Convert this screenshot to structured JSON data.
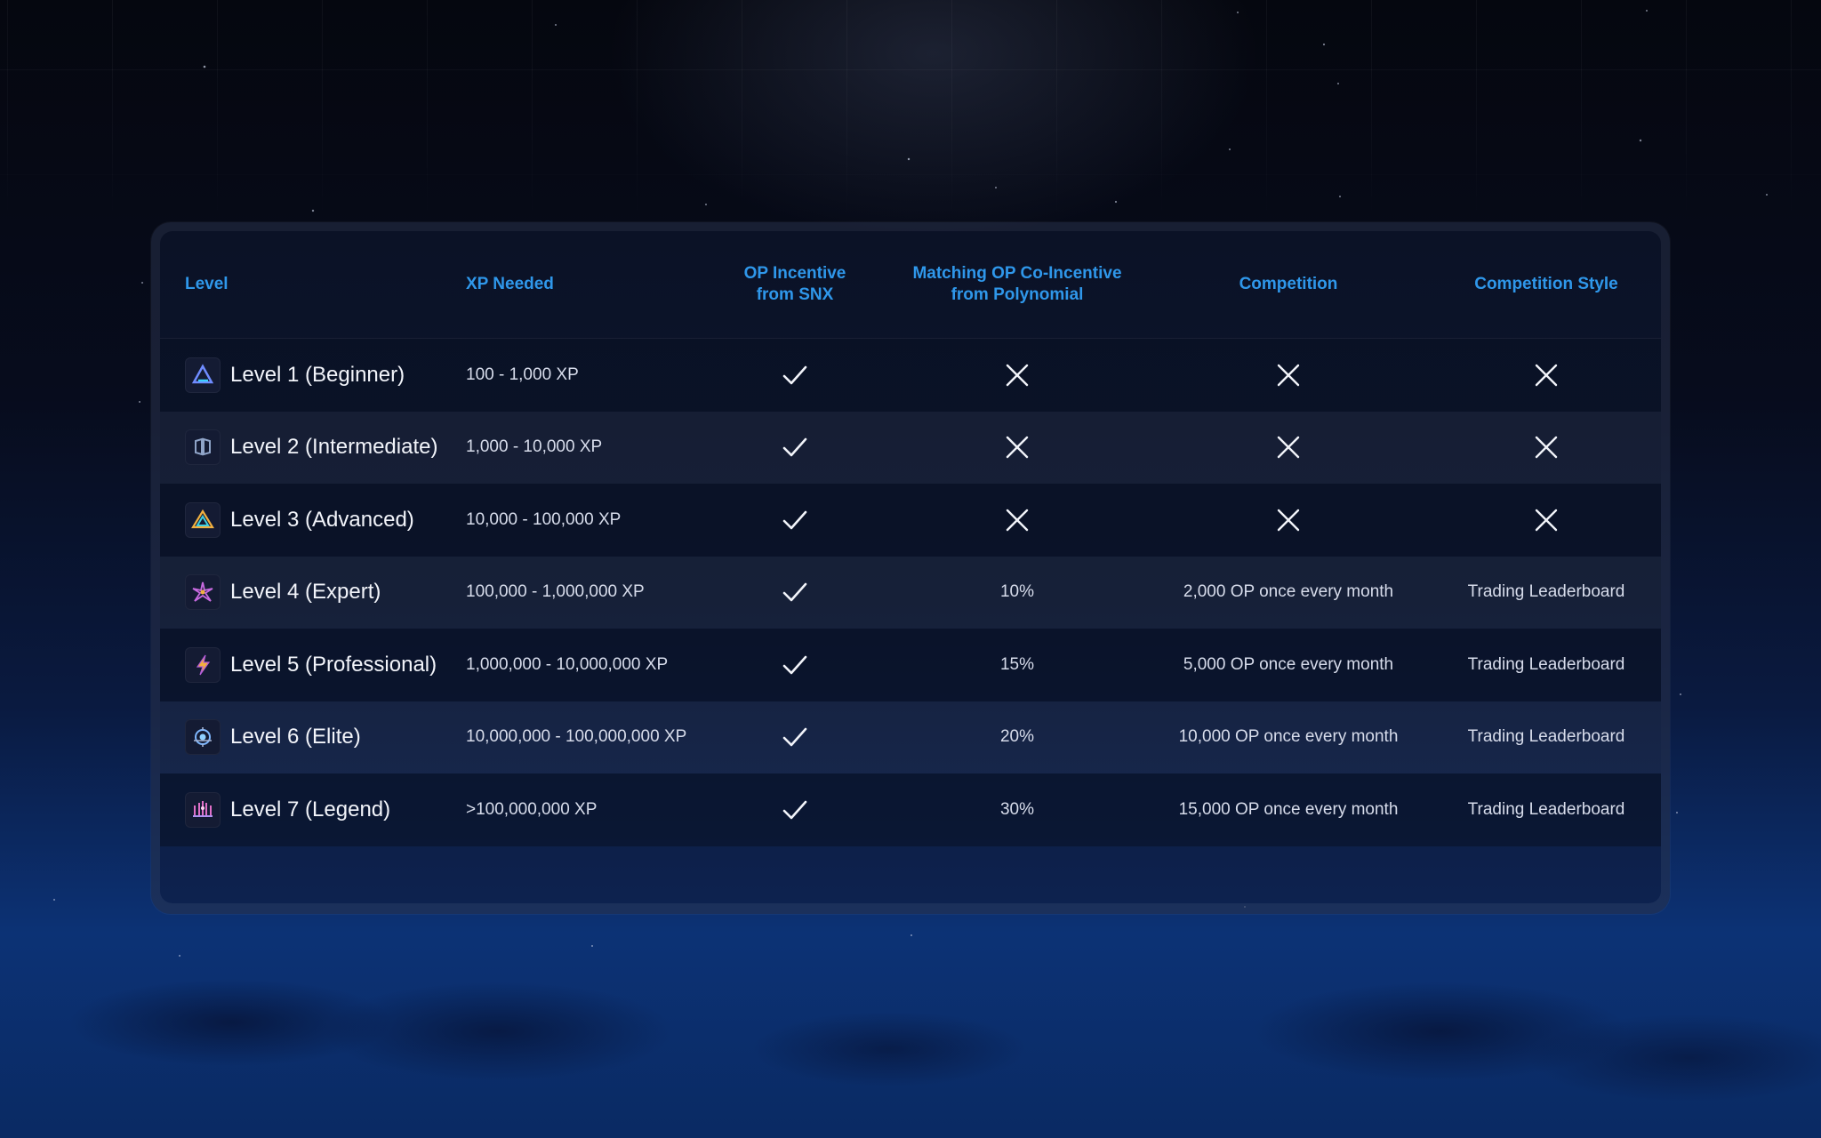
{
  "table": {
    "headers": {
      "level": "Level",
      "xp": "XP Needed",
      "op_snx": "OP Incentive\nfrom SNX",
      "matching": "Matching OP Co-Incentive\nfrom Polynomial",
      "competition": "Competition",
      "style": "Competition Style"
    },
    "rows": [
      {
        "level": "Level 1 (Beginner)",
        "xp": "100 - 1,000 XP",
        "op_snx": "check",
        "matching": "cross",
        "competition": "cross",
        "style": "cross",
        "icon": "triangle-icon"
      },
      {
        "level": "Level  2 (Intermediate)",
        "xp": "1,000 - 10,000 XP",
        "op_snx": "check",
        "matching": "cross",
        "competition": "cross",
        "style": "cross",
        "icon": "cube-icon"
      },
      {
        "level": "Level 3 (Advanced)",
        "xp": "10,000 - 100,000 XP",
        "op_snx": "check",
        "matching": "cross",
        "competition": "cross",
        "style": "cross",
        "icon": "prism-icon"
      },
      {
        "level": "Level 4 (Expert)",
        "xp": "100,000 - 1,000,000 XP",
        "op_snx": "check",
        "matching": "10%",
        "competition": "2,000 OP once every month",
        "style": "Trading Leaderboard",
        "icon": "burst-icon"
      },
      {
        "level": "Level 5 (Professional)",
        "xp": "1,000,000 - 10,000,000 XP",
        "op_snx": "check",
        "matching": "15%",
        "competition": "5,000 OP once every month",
        "style": "Trading Leaderboard",
        "icon": "lightning-icon"
      },
      {
        "level": "Level 6 (Elite)",
        "xp": "10,000,000 - 100,000,000 XP",
        "op_snx": "check",
        "matching": "20%",
        "competition": "10,000 OP once every month",
        "style": "Trading Leaderboard",
        "icon": "orb-icon"
      },
      {
        "level": "Level 7 (Legend)",
        "xp": ">100,000,000 XP",
        "op_snx": "check",
        "matching": "30%",
        "competition": "15,000 OP once every month",
        "style": "Trading Leaderboard",
        "icon": "crown-icon"
      }
    ]
  },
  "colors": {
    "header_text": "#2f97ea",
    "cell_text": "#d7dceb",
    "level_text": "#f2f4fa"
  }
}
